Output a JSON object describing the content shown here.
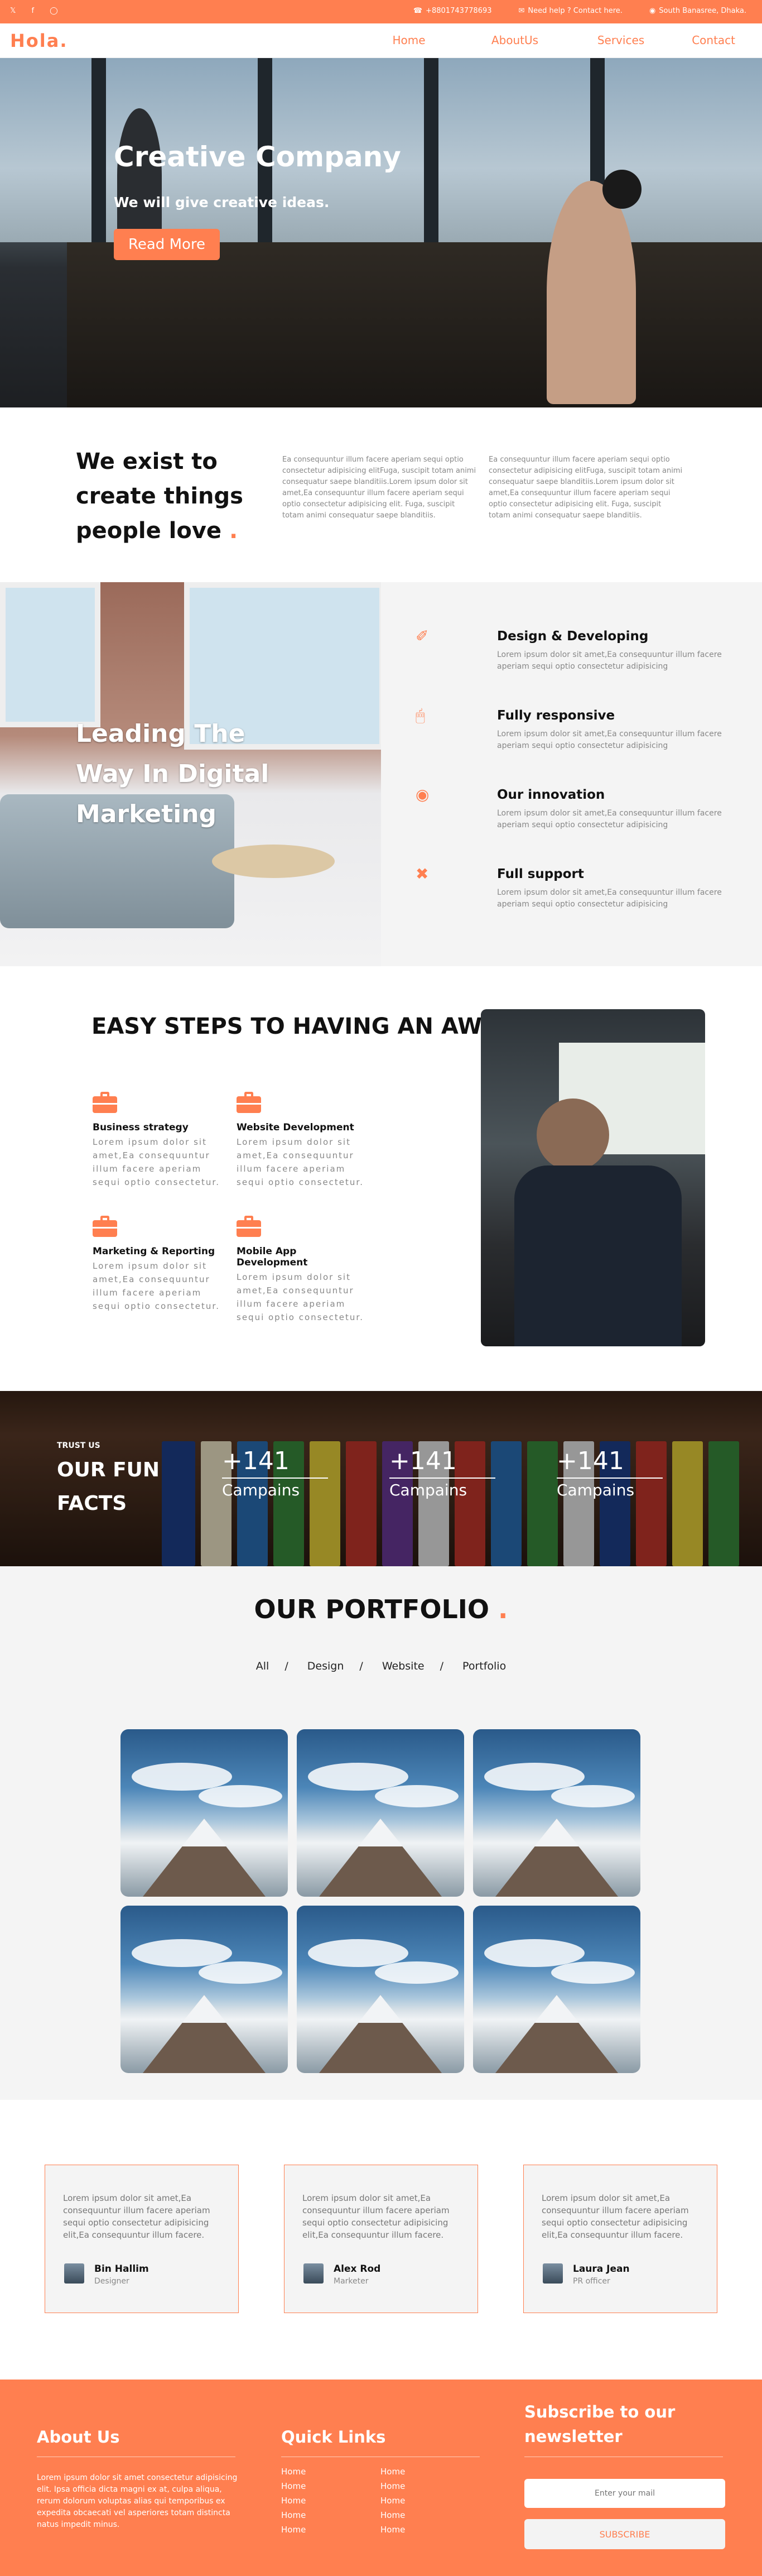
{
  "colors": {
    "accent": "#ff7f50",
    "dark": "#111111",
    "muted": "#888888",
    "panel": "#f4f4f4"
  },
  "topbar": {
    "social_icons": [
      "twitter-icon",
      "facebook-icon",
      "instagram-icon"
    ],
    "phone": "+8801743778693",
    "help": "Need help ? Contact here.",
    "location": "South Banasree, Dhaka."
  },
  "nav": {
    "logo": "Hola",
    "logo_dot": ".",
    "items": [
      "Home",
      "AboutUs",
      "Services",
      "Contact"
    ]
  },
  "hero": {
    "title": "Creative Company",
    "subtitle": "We will give creative ideas.",
    "button": "Read More"
  },
  "exist": {
    "title": "We exist to create things people love",
    "dot": ".",
    "col1": "Ea consequuntur illum facere aperiam sequi optio consectetur adipisicing elitFuga, suscipit totam animi consequatur saepe blanditiis.Lorem ipsum dolor sit amet,Ea consequuntur illum facere aperiam sequi optio consectetur adipisicing elit. Fuga, suscipit totam animi consequatur saepe blanditiis.",
    "col2": "Ea consequuntur illum facere aperiam sequi optio consectetur adipisicing elitFuga, suscipit totam animi consequatur saepe blanditiis.Lorem ipsum dolor sit amet,Ea consequuntur illum facere aperiam sequi optio consectetur adipisicing elit. Fuga, suscipit totam animi consequatur saepe blanditiis."
  },
  "leading": {
    "title": "Leading The Way In Digital Marketing",
    "features": [
      {
        "icon": "brush-icon",
        "title": "Design & Developing",
        "text": "Lorem ipsum dolor sit amet,Ea consequuntur illum facere aperiam sequi optio consectetur adipisicing"
      },
      {
        "icon": "monitor-icon",
        "title": "Fully responsive",
        "text": "Lorem ipsum dolor sit amet,Ea consequuntur illum facere aperiam sequi optio consectetur adipisicing"
      },
      {
        "icon": "lightbulb-icon",
        "title": "Our innovation",
        "text": "Lorem ipsum dolor sit amet,Ea consequuntur illum facere aperiam sequi optio consectetur adipisicing"
      },
      {
        "icon": "tools-icon",
        "title": "Full support",
        "text": "Lorem ipsum dolor sit amet,Ea consequuntur illum facere aperiam sequi optio consectetur adipisicing"
      }
    ]
  },
  "steps": {
    "title": "EASY STEPS TO HAVING AN AWESOME WEBSITE",
    "dot": ".",
    "items": [
      {
        "title": "Business strategy",
        "text": "Lorem ipsum dolor sit amet,Ea consequuntur illum facere aperiam sequi optio consectetur."
      },
      {
        "title": "Website Development",
        "text": "Lorem ipsum dolor sit amet,Ea consequuntur illum facere aperiam sequi optio consectetur."
      },
      {
        "title": "Marketing & Reporting",
        "text": "Lorem ipsum dolor sit amet,Ea consequuntur illum facere aperiam sequi optio consectetur."
      },
      {
        "title": "Mobile App Development",
        "text": "Lorem ipsum dolor sit amet,Ea consequuntur illum facere aperiam sequi optio consectetur."
      }
    ]
  },
  "facts": {
    "kicker": "TRUST US",
    "title": "OUR FUN FACTS",
    "items": [
      {
        "num": "+141",
        "label": "Campains"
      },
      {
        "num": "+141",
        "label": "Campains"
      },
      {
        "num": "+141",
        "label": "Campains"
      }
    ]
  },
  "portfolio": {
    "title": "OUR PORTFOLIO",
    "dot": ".",
    "filters": [
      "All",
      "Design",
      "Website",
      "Portfolio"
    ],
    "separator": "/"
  },
  "testimonials": [
    {
      "text": "Lorem ipsum dolor sit amet,Ea consequuntur illum facere aperiam sequi optio consectetur adipisicing elit,Ea consequuntur illum facere.",
      "name": "Bin Hallim",
      "role": "Designer"
    },
    {
      "text": "Lorem ipsum dolor sit amet,Ea consequuntur illum facere aperiam sequi optio consectetur adipisicing elit,Ea consequuntur illum facere.",
      "name": "Alex Rod",
      "role": "Marketer"
    },
    {
      "text": "Lorem ipsum dolor sit amet,Ea consequuntur illum facere aperiam sequi optio consectetur adipisicing elit,Ea consequuntur illum facere.",
      "name": "Laura Jean",
      "role": "PR officer"
    }
  ],
  "footer": {
    "about_title": "About Us",
    "about_text": "Lorem ipsum dolor sit amet consectetur adipisicing elit. Ipsa officia dicta magni ex at, culpa aliqua, rerum dolorum voluptas alias qui temporibus ex expedita obcaecati vel asperiores totam distincta natus impedit minus.",
    "links_title": "Quick Links",
    "links_col1": [
      "Home",
      "Home",
      "Home",
      "Home",
      "Home"
    ],
    "links_col2": [
      "Home",
      "Home",
      "Home",
      "Home",
      "Home"
    ],
    "subscribe_title": "Subscribe to our newsletter",
    "email_placeholder": "Enter your mail",
    "subscribe_button": "SUBSCRIBE"
  }
}
